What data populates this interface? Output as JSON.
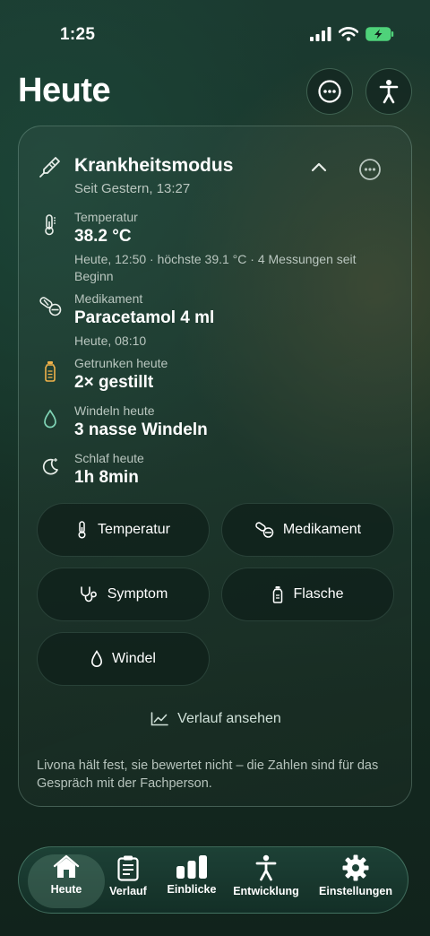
{
  "status_bar": {
    "time": "1:25"
  },
  "header": {
    "title": "Heute"
  },
  "card": {
    "title": "Krankheitsmodus",
    "subtitle": "Seit Gestern, 13:27",
    "metrics": [
      {
        "label": "Temperatur",
        "value": "38.2 °C",
        "detail": "Heute, 12:50 · höchste 39.1 °C · 4 Messungen seit Beginn",
        "icon": "thermometer-icon"
      },
      {
        "label": "Medikament",
        "value": "Paracetamol 4 ml",
        "detail": "Heute, 08:10",
        "icon": "pill-icon"
      },
      {
        "label": "Getrunken heute",
        "value": "2× gestillt",
        "icon": "bottle-icon"
      },
      {
        "label": "Windeln heute",
        "value": "3 nasse Windeln",
        "icon": "droplet-icon"
      },
      {
        "label": "Schlaf heute",
        "value": "1h 8min",
        "icon": "moon-icon"
      }
    ],
    "actions": [
      {
        "label": "Temperatur",
        "icon": "thermometer-icon"
      },
      {
        "label": "Medikament",
        "icon": "pill-icon"
      },
      {
        "label": "Symptom",
        "icon": "stethoscope-icon"
      },
      {
        "label": "Flasche",
        "icon": "bottle-icon"
      },
      {
        "label": "Windel",
        "icon": "droplet-icon"
      }
    ],
    "history_link": "Verlauf ansehen",
    "footnote": "Livona hält fest, sie bewertet nicht – die Zahlen sind für das Gespräch mit der Fachperson."
  },
  "tabbar": {
    "items": [
      {
        "label": "Heute",
        "icon": "home-icon",
        "active": true
      },
      {
        "label": "Verlauf",
        "icon": "clipboard-icon"
      },
      {
        "label": "Einblicke",
        "icon": "bar-chart-icon"
      },
      {
        "label": "Entwicklung",
        "icon": "person-icon"
      },
      {
        "label": "Einstellungen",
        "icon": "gear-icon"
      }
    ]
  },
  "colors": {
    "accent": "#f0b24a",
    "teal": "#7fd3b5",
    "battery": "#4fd27a"
  }
}
